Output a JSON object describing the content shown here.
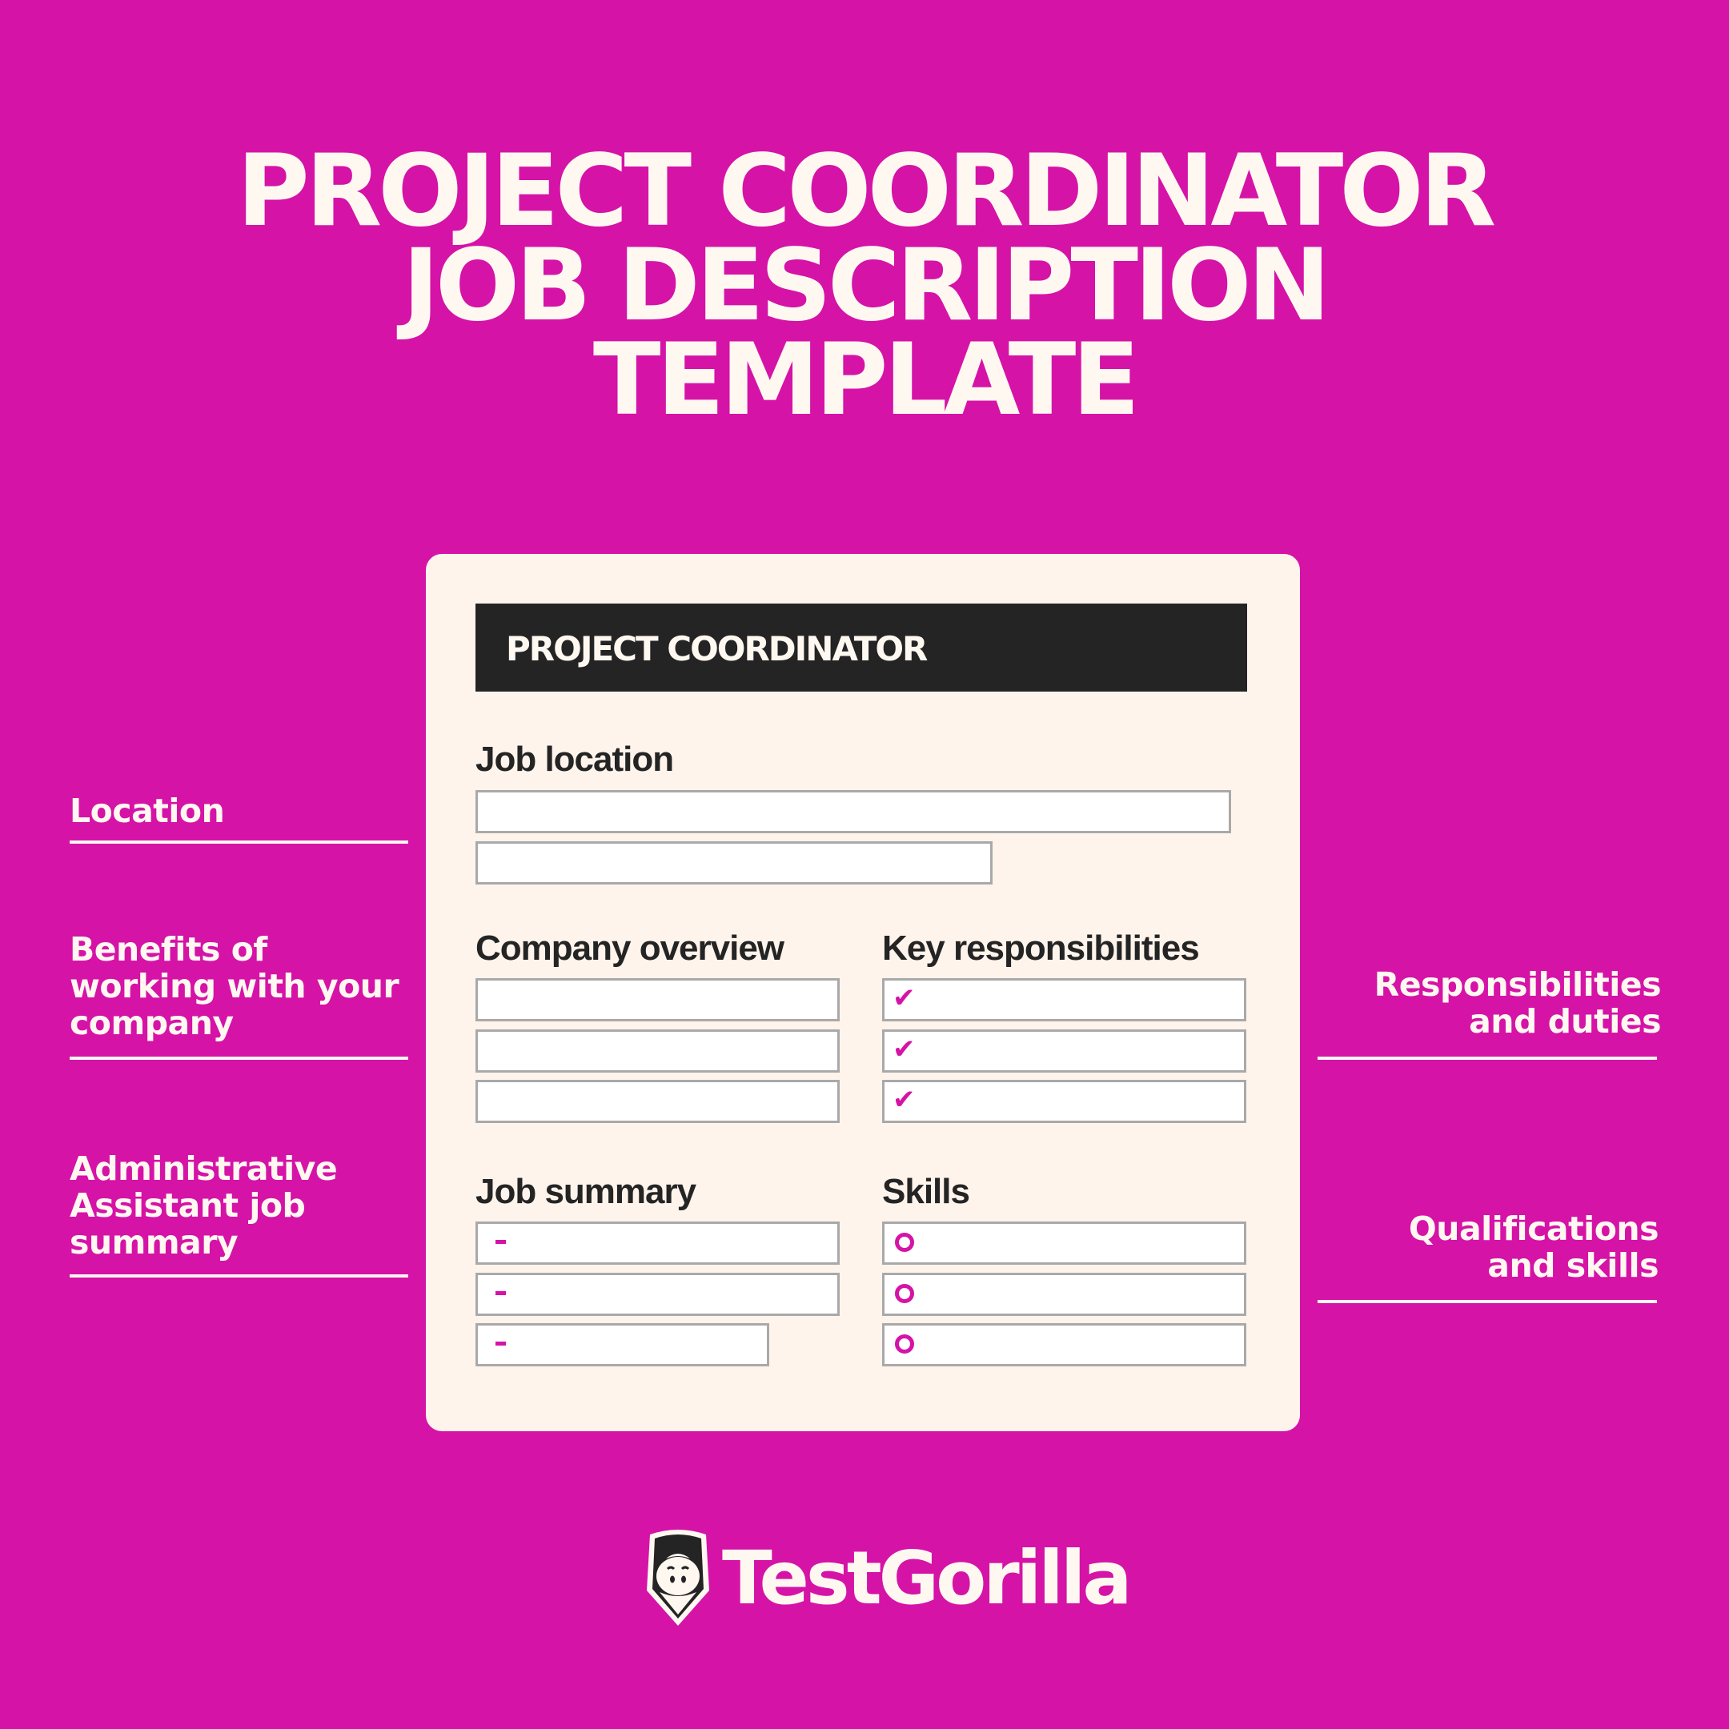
{
  "title": {
    "lines": [
      "PROJECT COORDINATOR",
      "JOB DESCRIPTION",
      "TEMPLATE"
    ]
  },
  "left_annotations": [
    {
      "label": "Location"
    },
    {
      "label": "Benefits of working with your company",
      "lines": [
        "Benefits of",
        "working with your",
        "company"
      ]
    },
    {
      "label": "Administrative Assistant job summary",
      "lines": [
        "Administrative",
        "Assistant job",
        "summary"
      ]
    }
  ],
  "right_annotations": [
    {
      "label": "Responsibilities and duties",
      "lines": [
        "Responsibilities",
        "and duties"
      ]
    },
    {
      "label": "Qualifications and skills",
      "lines": [
        "Qualifications",
        "and skills"
      ]
    }
  ],
  "card": {
    "header": "PROJECT COORDINATOR",
    "sections": {
      "job_location": {
        "label": "Job location",
        "fields": 2
      },
      "company_overview": {
        "label": "Company overview",
        "fields": 3
      },
      "key_responsibilities": {
        "label": "Key responsibilities",
        "fields": 3,
        "marker_icon": "check-icon"
      },
      "job_summary": {
        "label": "Job summary",
        "fields": 3,
        "marker_icon": "dash-icon"
      },
      "skills": {
        "label": "Skills",
        "fields": 3,
        "marker_icon": "ring-bullet-icon"
      }
    },
    "check_glyph": "✔"
  },
  "brand": {
    "name": "TestGorilla",
    "logo_icon": "gorilla-shield-icon"
  },
  "colors": {
    "background": "#d513a7",
    "card": "#fff4ec",
    "header": "#242424",
    "text_light": "#fff8f1",
    "accent": "#d513a7",
    "field_border": "#a9a9a9"
  }
}
